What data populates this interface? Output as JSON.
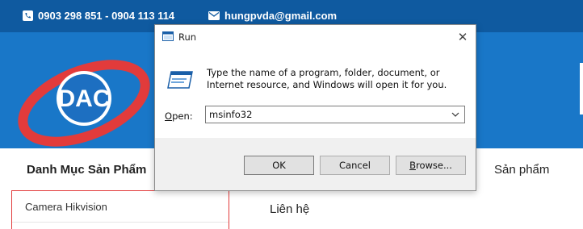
{
  "site": {
    "phone": "0903 298 851 - 0904 113 114",
    "email": "hungpvda@gmail.com",
    "logo_text": "DAC",
    "nav": {
      "categories": "Danh Mục Sản Phẩm",
      "products": "Sản phẩm",
      "contact": "Liên hệ"
    },
    "category_item": "Camera Hikvision",
    "colors": {
      "topbar": "#0f5aa0",
      "header": "#1977c8",
      "logo_red": "#e23b3b",
      "logo_blue": "#1d6fc1"
    }
  },
  "dialog": {
    "title": "Run",
    "close": "✕",
    "description": "Type the name of a program, folder, document, or Internet resource, and Windows will open it for you.",
    "open_label_hotkey": "O",
    "open_label_rest": "pen:",
    "open_value": "msinfo32",
    "buttons": {
      "ok": "OK",
      "cancel": "Cancel",
      "browse_hotkey": "B",
      "browse_rest": "rowse..."
    }
  }
}
